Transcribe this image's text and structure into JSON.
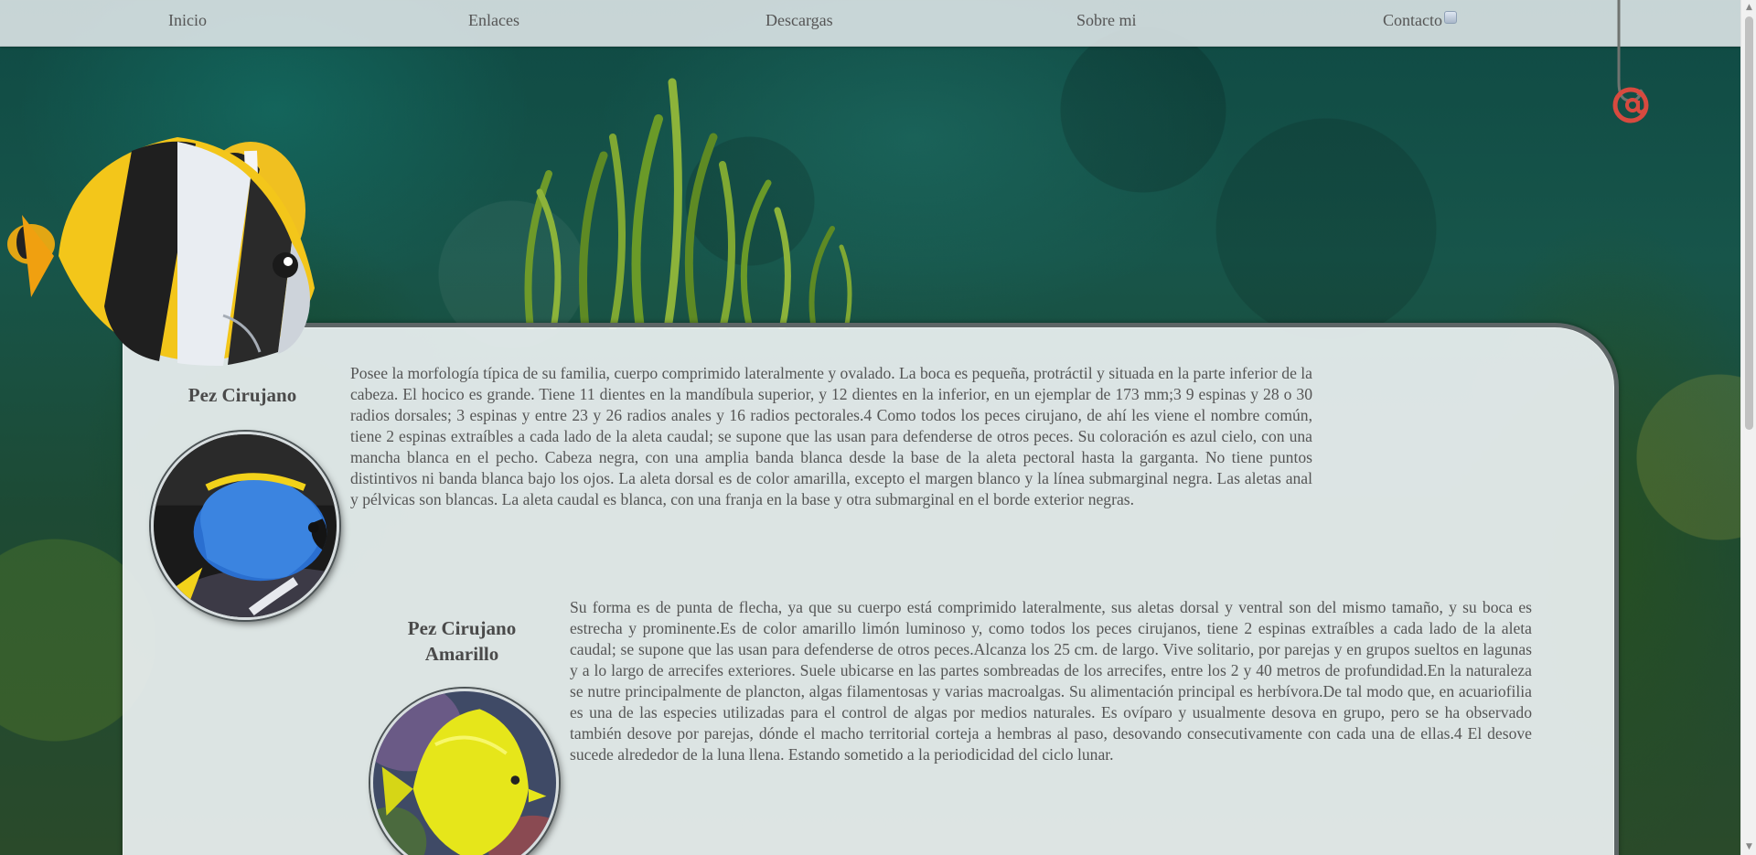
{
  "nav": {
    "items": [
      {
        "label": "Inicio"
      },
      {
        "label": "Enlaces"
      },
      {
        "label": "Descargas"
      },
      {
        "label": "Sobre mi"
      },
      {
        "label": "Contacto"
      }
    ]
  },
  "sections": [
    {
      "title_line1": "Pez Cirujano",
      "title_line2": "",
      "image": "blue-tang-photo",
      "text": "Posee la morfología típica de su familia, cuerpo comprimido lateralmente y ovalado. La boca es pequeña, protráctil y situada en la parte inferior de la cabeza. El hocico es grande. Tiene 11 dientes en la mandíbula superior, y 12 dientes en la inferior, en un ejemplar de 173 mm;3 9 espinas y 28 o 30 radios dorsales; 3 espinas y entre 23 y 26 radios anales y 16 radios pectorales.4 Como todos los peces cirujano, de ahí les viene el nombre común, tiene 2 espinas extraíbles a cada lado de la aleta caudal; se supone que las usan para defenderse de otros peces. Su coloración es azul cielo, con una mancha blanca en el pecho. Cabeza negra, con una amplia banda blanca desde la base de la aleta pectoral hasta la garganta. No tiene puntos distintivos ni banda blanca bajo los ojos. La aleta dorsal es de color amarilla, excepto el margen blanco y la línea submarginal negra. Las aletas anal y pélvicas son blancas. La aleta caudal es blanca, con una franja en la base y otra submarginal en el borde exterior negras."
    },
    {
      "title_line1": "Pez Cirujano",
      "title_line2": "Amarillo",
      "image": "yellow-tang-photo",
      "text": "Su forma es de punta de flecha, ya que su cuerpo está comprimido lateralmente, sus aletas dorsal y ventral son del mismo tamaño, y su boca es estrecha y prominente.Es de color amarillo limón luminoso y, como todos los peces cirujanos, tiene 2 espinas extraíbles a cada lado de la aleta caudal; se supone que las usan para defenderse de otros peces.Alcanza los 25 cm. de largo. Vive solitario, por parejas y en grupos sueltos en lagunas y a lo largo de arrecifes exteriores. Suele ubicarse en las partes sombreadas de los arrecifes, entre los 2 y 40 metros de profundidad.En la naturaleza se nutre principalmente de plancton, algas filamentosas y varias macroalgas. Su alimentación principal es herbívora.De tal modo que, en acuariofilia es una de las especies utilizadas para el control de algas por medios naturales. Es ovíparo y usualmente desova en grupo, pero se ha observado también desove por parejas, dónde el macho territorial corteja a hembras al paso, desovando consecutivamente con cada una de ellas.4 El desove sucede alrededor de la luna llena. Estando sometido a la periodicidad del ciclo lunar."
    }
  ],
  "colors": {
    "panel": "#ebf0f1",
    "panel_border": "#5d6566",
    "nav_bg": "#e1e8ea",
    "text": "#555555"
  }
}
